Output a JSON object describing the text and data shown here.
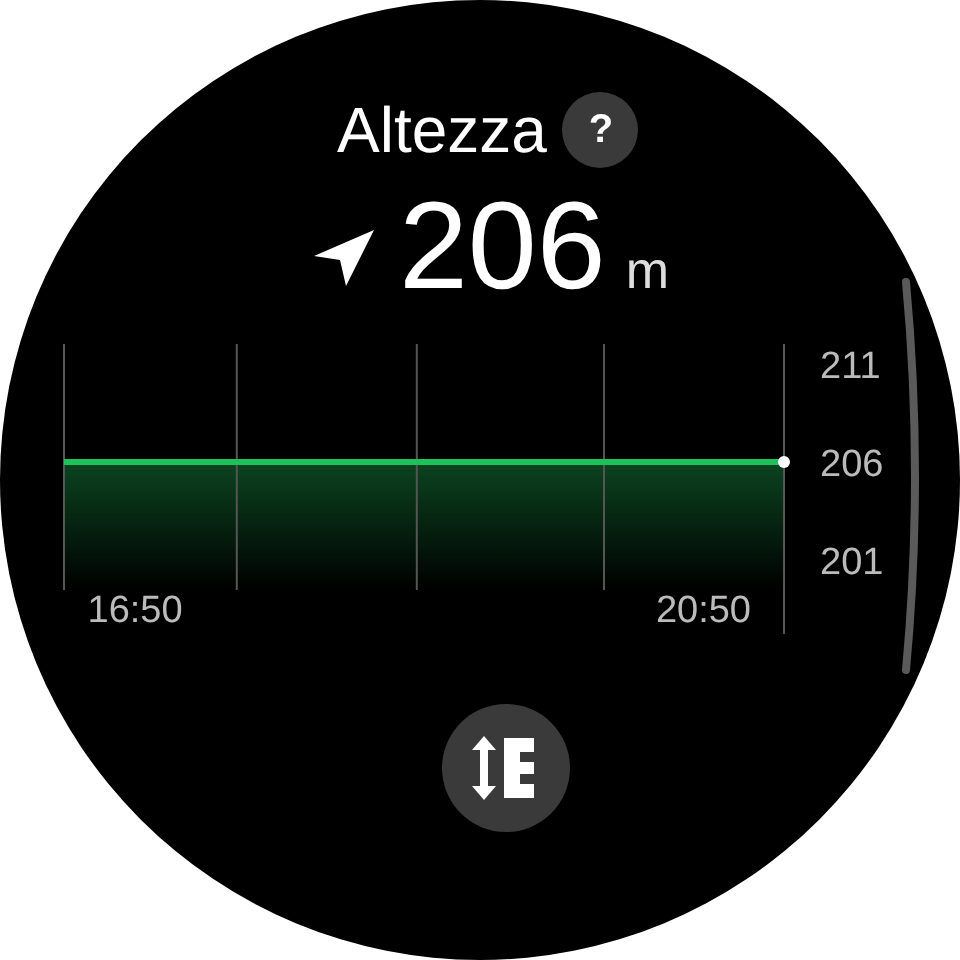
{
  "screen": {
    "title": "Altezza",
    "help": "?"
  },
  "reading": {
    "value": "206",
    "unit": "m"
  },
  "chart": {
    "chart_data": {
      "type": "line",
      "x": [
        980,
        1284
      ],
      "xlim": [
        980,
        1284
      ],
      "xticks": [
        {
          "value": 1010,
          "label": "16:50"
        },
        {
          "value": 1250,
          "label": "20:50"
        }
      ],
      "series": [
        {
          "color": "#1fc25a",
          "values": [
            206,
            206
          ]
        }
      ],
      "ylim": [
        199.5,
        212
      ],
      "yticks": [
        201,
        206,
        211
      ]
    }
  },
  "button": {
    "kind": "altitude"
  }
}
